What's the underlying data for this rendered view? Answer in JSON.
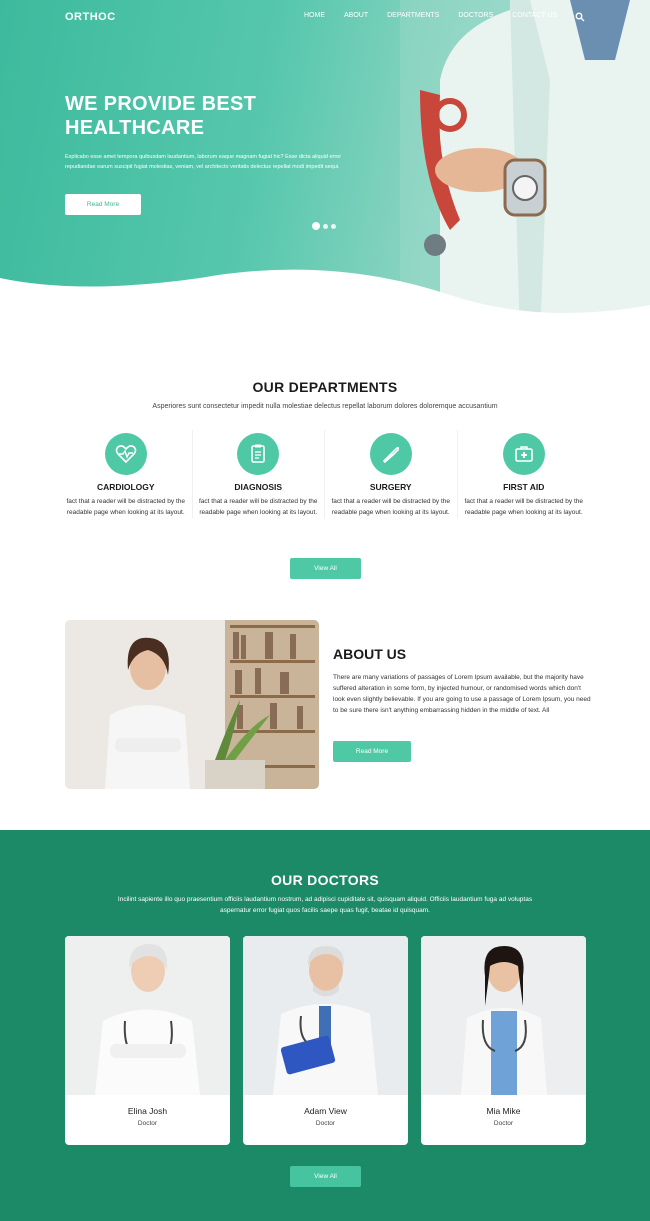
{
  "header": {
    "brand": "ORTHOC",
    "nav": [
      "HOME",
      "ABOUT",
      "DEPARTMENTS",
      "DOCTORS",
      "CONTACT US"
    ]
  },
  "hero": {
    "title": "WE PROVIDE BEST HEALTHCARE",
    "description": "Explicabo esse amet tempora quibusdam laudantium, laborum eaque magnam fugiat hic? Esse dicta aliquid error repudiandae earum suscipit fugiat molestias, veniam, vel architecto veritatis delectus repellat modi impedit sequi.",
    "button": "Read More",
    "slides_total": 3,
    "slide_active": 1
  },
  "departments": {
    "title": "OUR DEPARTMENTS",
    "subtitle": "Asperiores sunt consectetur impedit nulla molestiae delectus repellat laborum dolores doloremque accusantium",
    "items": [
      {
        "name": "CARDIOLOGY",
        "text": "fact that a reader will be distracted by the readable page when looking at its layout.",
        "icon": "heart-pulse-icon"
      },
      {
        "name": "DIAGNOSIS",
        "text": "fact that a reader will be distracted by the readable page when looking at its layout.",
        "icon": "clipboard-icon"
      },
      {
        "name": "SURGERY",
        "text": "fact that a reader will be distracted by the readable page when looking at its layout.",
        "icon": "scalpel-icon"
      },
      {
        "name": "FIRST AID",
        "text": "fact that a reader will be distracted by the readable page when looking at its layout.",
        "icon": "first-aid-kit-icon"
      }
    ],
    "button": "View All"
  },
  "about": {
    "title": "ABOUT US",
    "text": "There are many variations of passages of Lorem Ipsum available, but the majority have suffered alteration in some form, by injected humour, or randomised words which don't look even slightly believable. If you are going to use a passage of Lorem Ipsum, you need to be sure there isn't anything embarrassing hidden in the middle of text. All",
    "button": "Read More"
  },
  "doctors": {
    "title": "OUR DOCTORS",
    "subtitle": "Incilint sapiente illo quo praesentium officiis laudantium nostrum, ad adipisci cupiditate sit, quisquam aliquid. Officiis laudantium fuga ad voluptas aspernatur error fugiat quos facilis saepe quas fugit, beatae id quisquam.",
    "items": [
      {
        "name": "Elina Josh",
        "role": "Doctor"
      },
      {
        "name": "Adam View",
        "role": "Doctor"
      },
      {
        "name": "Mia Mike",
        "role": "Doctor"
      }
    ],
    "button": "View All"
  },
  "colors": {
    "accent": "#4fc8a6",
    "hero": "#3dba9d",
    "doctors_bg": "#1c8a67"
  }
}
